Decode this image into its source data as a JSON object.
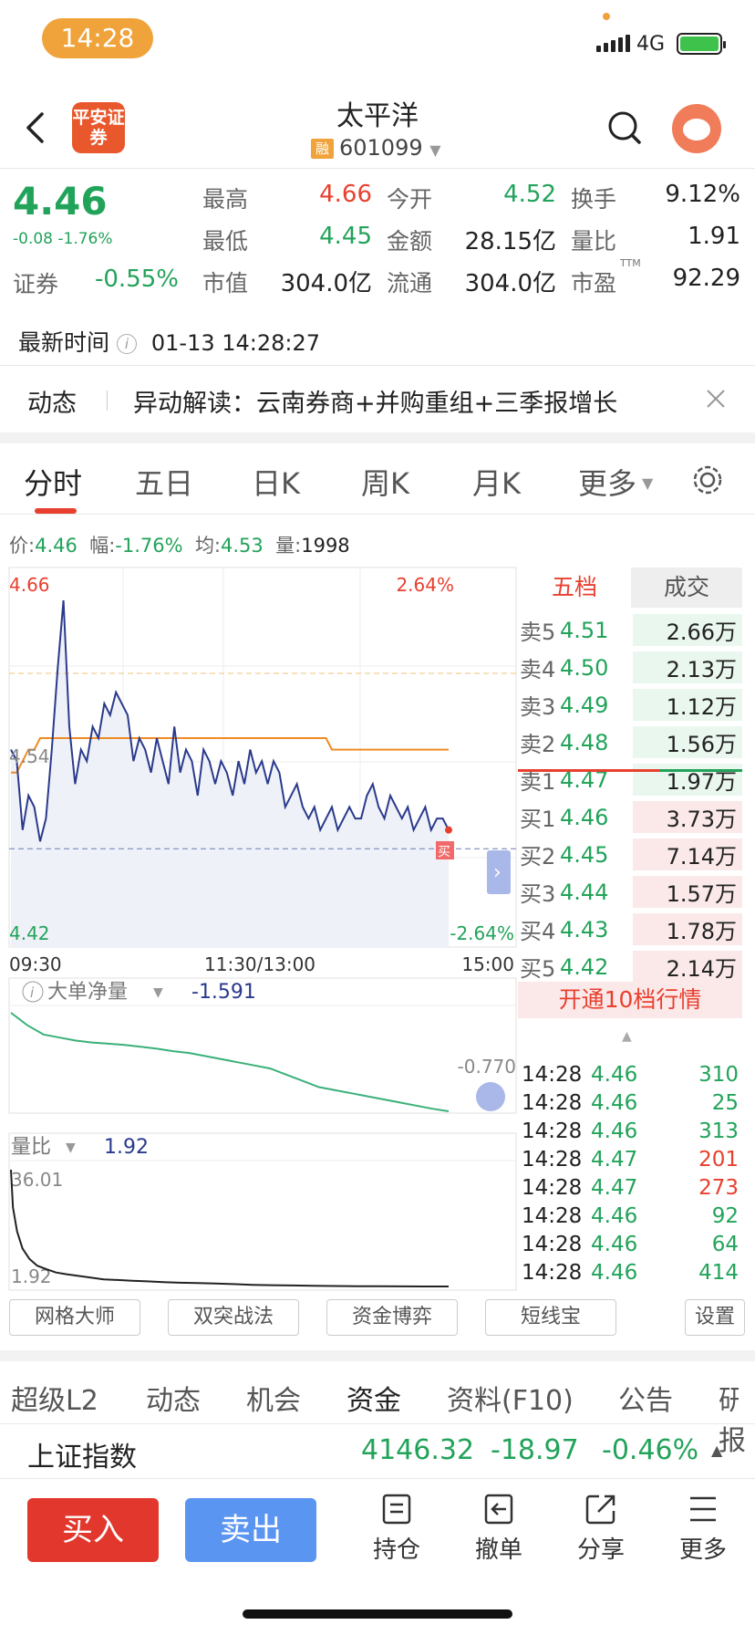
{
  "status": {
    "time": "14:28",
    "network": "4G"
  },
  "header": {
    "logo_text": "平安证券",
    "title": "太平洋",
    "margin_badge": "融",
    "code": "601099"
  },
  "quote": {
    "price": "4.46",
    "change": "-0.08 -1.76%",
    "sector_label": "证券",
    "sector_value": "-0.55%",
    "stats": [
      {
        "label": "最高",
        "value": "4.66",
        "color": "red"
      },
      {
        "label": "今开",
        "value": "4.52",
        "color": "green"
      },
      {
        "label": "换手",
        "value": "9.12%",
        "color": "black"
      },
      {
        "label": "最低",
        "value": "4.45",
        "color": "green"
      },
      {
        "label": "金额",
        "value": "28.15亿",
        "color": "black"
      },
      {
        "label": "量比",
        "value": "1.91",
        "color": "black"
      },
      {
        "label": "市值",
        "value": "304.0亿",
        "color": "black"
      },
      {
        "label": "流通",
        "value": "304.0亿",
        "color": "black"
      },
      {
        "label": "市盈",
        "value": "92.29",
        "color": "black",
        "sup": "TTM"
      }
    ],
    "latest_time_label": "最新时间",
    "latest_time": "01-13 14:28:27"
  },
  "news": {
    "label": "动态",
    "text": "异动解读：云南券商+并购重组+三季报增长"
  },
  "chart_tabs": [
    "分时",
    "五日",
    "日K",
    "周K",
    "月K",
    "更多"
  ],
  "info_line": {
    "price_label": "价:",
    "price": "4.46",
    "amp_label": "幅:",
    "amp": "-1.76%",
    "avg_label": "均:",
    "avg": "4.53",
    "vol_label": "量:",
    "vol": "1998"
  },
  "chart_data": [
    {
      "type": "line",
      "title": "",
      "x_ticks": [
        "09:30",
        "11:30/13:00",
        "15:00"
      ],
      "y_left_labels": [
        "4.66",
        "4.54",
        "4.42"
      ],
      "y_right_labels": [
        "2.64%",
        "-2.64%"
      ],
      "ylim": [
        4.42,
        4.66
      ],
      "series": [
        {
          "name": "价",
          "color": "#2a3a8c",
          "values": [
            4.53,
            4.52,
            4.46,
            4.49,
            4.48,
            4.45,
            4.47,
            4.53,
            4.6,
            4.66,
            4.55,
            4.5,
            4.53,
            4.52,
            4.55,
            4.54,
            4.57,
            4.56,
            4.58,
            4.57,
            4.56,
            4.52,
            4.54,
            4.53,
            4.51,
            4.54,
            4.52,
            4.5,
            4.55,
            4.51,
            4.53,
            4.52,
            4.49,
            4.53,
            4.52,
            4.5,
            4.52,
            4.51,
            4.49,
            4.52,
            4.5,
            4.53,
            4.51,
            4.52,
            4.5,
            4.52,
            4.51,
            4.48,
            4.49,
            4.5,
            4.48,
            4.47,
            4.48,
            4.46,
            4.47,
            4.48,
            4.46,
            4.47,
            4.48,
            4.47,
            4.47,
            4.49,
            4.5,
            4.48,
            4.47,
            4.49,
            4.48,
            4.47,
            4.48,
            4.46,
            4.47,
            4.48,
            4.46,
            4.47,
            4.47,
            4.46
          ]
        },
        {
          "name": "均",
          "color": "#f08a24",
          "values": [
            4.51,
            4.51,
            4.52,
            4.53,
            4.53,
            4.54,
            4.54,
            4.54,
            4.54,
            4.54,
            4.54,
            4.54,
            4.54,
            4.54,
            4.54,
            4.54,
            4.54,
            4.54,
            4.54,
            4.54,
            4.54,
            4.54,
            4.54,
            4.54,
            4.54,
            4.54,
            4.54,
            4.54,
            4.54,
            4.54,
            4.54,
            4.54,
            4.54,
            4.54,
            4.54,
            4.54,
            4.54,
            4.54,
            4.54,
            4.54,
            4.54,
            4.54,
            4.54,
            4.54,
            4.54,
            4.54,
            4.54,
            4.54,
            4.54,
            4.54,
            4.54,
            4.54,
            4.54,
            4.54,
            4.54,
            4.53,
            4.53,
            4.53,
            4.53,
            4.53,
            4.53,
            4.53,
            4.53,
            4.53,
            4.53,
            4.53,
            4.53,
            4.53,
            4.53,
            4.53,
            4.53,
            4.53,
            4.53,
            4.53,
            4.53,
            4.53
          ]
        }
      ],
      "ref_price": 4.54,
      "marker_label": "买"
    },
    {
      "type": "line",
      "title": "大单净量",
      "value_label": "-1.591",
      "right_label": "-0.770",
      "series": [
        {
          "name": "大单净量",
          "color": "#3ab07a",
          "values": [
            0.0,
            -0.2,
            -0.35,
            -0.4,
            -0.45,
            -0.48,
            -0.5,
            -0.52,
            -0.55,
            -0.58,
            -0.62,
            -0.65,
            -0.7,
            -0.75,
            -0.8,
            -0.85,
            -0.9,
            -1.0,
            -1.1,
            -1.2,
            -1.25,
            -1.3,
            -1.35,
            -1.4,
            -1.45,
            -1.5,
            -1.55,
            -1.591
          ]
        }
      ]
    },
    {
      "type": "line",
      "title": "量比",
      "value_label": "1.92",
      "y_labels": [
        "36.01",
        "1.92"
      ],
      "series": [
        {
          "name": "量比",
          "color": "#222",
          "values": [
            36.01,
            25,
            18,
            13,
            10,
            8,
            7,
            6,
            5.5,
            5,
            4.5,
            4,
            3.8,
            3.6,
            3.4,
            3.2,
            3.0,
            2.9,
            2.8,
            2.6,
            2.4,
            2.3,
            2.2,
            2.1,
            2.05,
            2.0,
            1.96,
            1.94,
            1.93,
            1.92
          ]
        }
      ]
    }
  ],
  "order_book": {
    "tabs": [
      "五档",
      "成交"
    ],
    "sells": [
      {
        "k": "卖5",
        "p": "4.51",
        "v": "2.66万"
      },
      {
        "k": "卖4",
        "p": "4.50",
        "v": "2.13万"
      },
      {
        "k": "卖3",
        "p": "4.49",
        "v": "1.12万"
      },
      {
        "k": "卖2",
        "p": "4.48",
        "v": "1.56万"
      },
      {
        "k": "卖1",
        "p": "4.47",
        "v": "1.97万"
      }
    ],
    "buys": [
      {
        "k": "买1",
        "p": "4.46",
        "v": "3.73万"
      },
      {
        "k": "买2",
        "p": "4.45",
        "v": "7.14万"
      },
      {
        "k": "买3",
        "p": "4.44",
        "v": "1.57万"
      },
      {
        "k": "买4",
        "p": "4.43",
        "v": "1.78万"
      },
      {
        "k": "买5",
        "p": "4.42",
        "v": "2.14万"
      }
    ],
    "open_l10": "开通10档行情",
    "deals": [
      {
        "t": "14:28",
        "p": "4.46",
        "v": "310",
        "c": "green"
      },
      {
        "t": "14:28",
        "p": "4.46",
        "v": "25",
        "c": "green"
      },
      {
        "t": "14:28",
        "p": "4.46",
        "v": "313",
        "c": "green"
      },
      {
        "t": "14:28",
        "p": "4.47",
        "v": "201",
        "c": "red"
      },
      {
        "t": "14:28",
        "p": "4.47",
        "v": "273",
        "c": "red"
      },
      {
        "t": "14:28",
        "p": "4.46",
        "v": "92",
        "c": "green"
      },
      {
        "t": "14:28",
        "p": "4.46",
        "v": "64",
        "c": "green"
      },
      {
        "t": "14:28",
        "p": "4.46",
        "v": "414",
        "c": "green"
      }
    ]
  },
  "tools": [
    "网格大师",
    "双突战法",
    "资金博弈",
    "短线宝",
    "设置"
  ],
  "bottom_tabs": [
    "超级L2",
    "动态",
    "机会",
    "资金",
    "资料(F10)",
    "公告",
    "研报"
  ],
  "index": {
    "name": "上证指数",
    "value": "4146.32",
    "change": "-18.97",
    "pct": "-0.46%"
  },
  "actions": {
    "buy": "买入",
    "sell": "卖出",
    "hold": "持仓",
    "cancel": "撤单",
    "share": "分享",
    "more": "更多"
  }
}
